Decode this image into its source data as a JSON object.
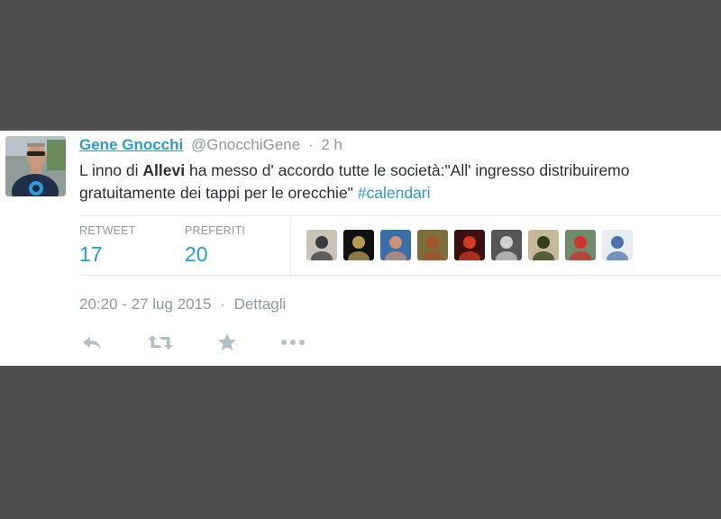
{
  "tweet": {
    "fullname": "Gene Gnocchi",
    "handle": "@GnocchiGene",
    "separator": "·",
    "time": "2 h",
    "text_part1": "L inno di ",
    "text_bold": "Allevi",
    "text_part2": " ha messo d' accordo tutte le società:\"All' ingresso distribuiremo gratuitamente dei tappi per le orecchie\" ",
    "hashtag": "#calendari"
  },
  "stats": {
    "retweet_label": "RETWEET",
    "retweet_count": "17",
    "favorites_label": "PREFERITI",
    "favorites_count": "20"
  },
  "favorited_by": [
    {
      "name": "user-avatar-1",
      "color": "#c9c2b6",
      "accent": "#3b3b3b"
    },
    {
      "name": "user-avatar-2",
      "color": "#111111",
      "accent": "#b59a57"
    },
    {
      "name": "user-avatar-3",
      "color": "#3b6da8",
      "accent": "#c99377"
    },
    {
      "name": "user-avatar-4",
      "color": "#7d6d3a",
      "accent": "#a3532f"
    },
    {
      "name": "user-avatar-5",
      "color": "#3a1010",
      "accent": "#d33a1f"
    },
    {
      "name": "user-avatar-6",
      "color": "#565656",
      "accent": "#cfcfcf"
    },
    {
      "name": "user-avatar-7",
      "color": "#c7b89a",
      "accent": "#2f3d18"
    },
    {
      "name": "user-avatar-8",
      "color": "#6e8b6a",
      "accent": "#d22f2f"
    },
    {
      "name": "user-avatar-9",
      "color": "#e7ecf2",
      "accent": "#4f72a8"
    }
  ],
  "footer": {
    "datetime": "20:20 - 27 lug 2015",
    "separator": "·",
    "details": "Dettagli"
  },
  "actions": {
    "reply_icon": "reply-icon",
    "retweet_icon": "retweet-icon",
    "favorite_icon": "star-icon",
    "more_icon": "more-dots-icon"
  },
  "colors": {
    "link": "#2a9ad0",
    "muted": "#8b98a2",
    "text": "#292f33",
    "backdrop": "#4f4f4f"
  }
}
